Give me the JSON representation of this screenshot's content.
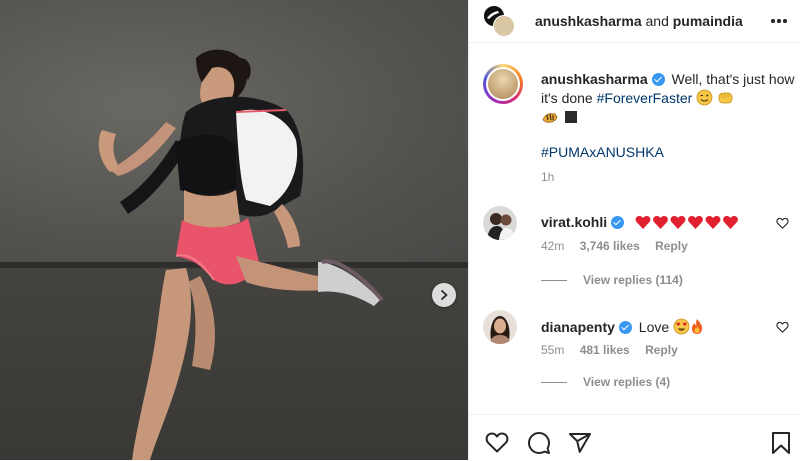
{
  "header": {
    "account_1": "anushkasharma",
    "conjunction": "and",
    "account_2": "pumaindia",
    "icons": {
      "more": "more-options-icon"
    }
  },
  "photo": {
    "description_alt": "",
    "next_icon": "chevron-right-icon"
  },
  "caption": {
    "username": "anushkasharma",
    "text": "Well, that's just how it's done",
    "hashtag1": "#ForeverFaster",
    "hashtag2": "#PUMAxANUSHKA",
    "time": "1h",
    "emojis": [
      "wink-emoji",
      "fist-emoji",
      "tiger-emoji",
      "black-square-emoji"
    ]
  },
  "comments": [
    {
      "username": "virat.kohli",
      "text_emojis": [
        "red-heart-emoji",
        "red-heart-emoji",
        "red-heart-emoji",
        "red-heart-emoji",
        "red-heart-emoji",
        "red-heart-emoji"
      ],
      "time": "42m",
      "likes": "3,746 likes",
      "reply_label": "Reply",
      "view_replies": "View replies (114)"
    },
    {
      "username": "dianapenty",
      "text": "Love",
      "text_emojis": [
        "heart-eyes-emoji",
        "fire-emoji"
      ],
      "time": "55m",
      "likes": "481 likes",
      "reply_label": "Reply",
      "view_replies": "View replies (4)"
    }
  ],
  "footer": {
    "icons": [
      "like-heart-icon",
      "comment-icon",
      "share-icon",
      "save-bookmark-icon"
    ]
  },
  "colors": {
    "text": "#262626",
    "secondary": "#8e8e8e",
    "link": "#00376b",
    "verified": "#3897f0",
    "heart_red": "#ed4956",
    "border": "#efefef"
  }
}
